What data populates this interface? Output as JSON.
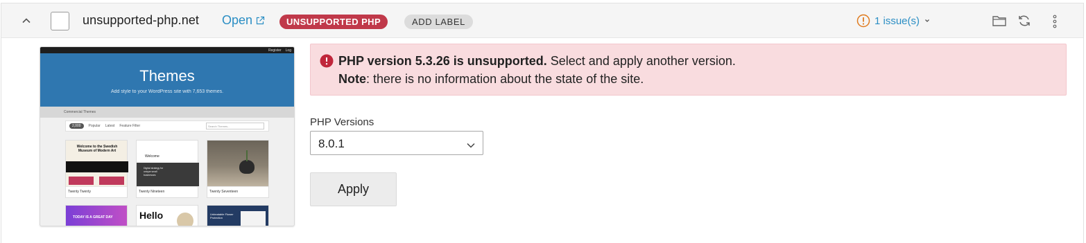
{
  "site": {
    "domain": "unsupported-php.net",
    "open_label": "Open",
    "status_badge": "UNSUPPORTED PHP",
    "add_label": "ADD LABEL",
    "issues_label": "1 issue(s)"
  },
  "thumbnail": {
    "topbar_links": [
      "Register",
      "Log"
    ],
    "hero_title": "Themes",
    "hero_subtitle": "Add style to your WordPress site with 7,653 themes.",
    "strip_text": "Commercial Themes",
    "filter": {
      "count": "2,000",
      "tabs": [
        "Popular",
        "Latest"
      ],
      "feature_filter": "Feature Filter",
      "search_placeholder": "Search Themes..."
    },
    "cards": [
      {
        "caption": "Twenty Twenty",
        "headline": "Welcome to the Swedish Museum of Modern Art"
      },
      {
        "caption": "Twenty Nineteen",
        "headline": "Welcome",
        "subtext": "Digital strategy for unique small businesses"
      },
      {
        "caption": "Twenty Seventeen"
      },
      {
        "banner": "TODAY IS A GREAT DAY"
      },
      {
        "headline": "Hello"
      },
      {
        "headline": "Unbeatable Flower Protection"
      }
    ]
  },
  "alert": {
    "line1_bold": "PHP version 5.3.26 is unsupported.",
    "line1_rest": " Select and apply another version.",
    "line2_bold": "Note",
    "line2_rest": ": there is no information about the state of the site."
  },
  "php": {
    "label": "PHP Versions",
    "selected": "8.0.1",
    "apply_label": "Apply"
  },
  "colors": {
    "accent": "#2b8ec4",
    "danger_badge": "#c0394a",
    "alert_bg": "#f9dcdf",
    "alert_icon": "#c0263b",
    "warning_icon": "#e07b1f"
  },
  "icons": {
    "collapse": "chevron-up-icon",
    "external": "external-link-icon",
    "warning": "warning-circle-icon",
    "dropdown": "chevron-down-icon",
    "folder": "folder-icon",
    "refresh": "refresh-icon",
    "more": "more-vertical-icon",
    "error": "error-circle-icon"
  }
}
